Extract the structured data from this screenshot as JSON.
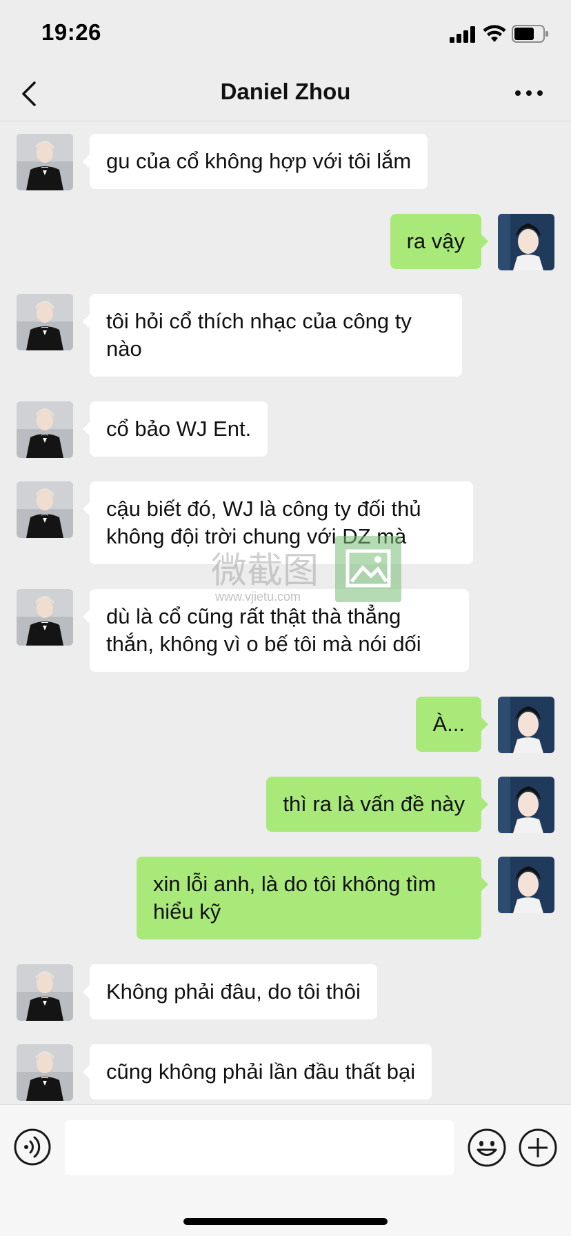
{
  "status_bar": {
    "time": "19:26"
  },
  "header": {
    "title": "Daniel Zhou"
  },
  "messages": [
    {
      "side": "left",
      "text": "gu của cổ không hợp với tôi lắm"
    },
    {
      "side": "right",
      "text": "ra vậy"
    },
    {
      "side": "left",
      "text": "tôi hỏi cổ thích nhạc của công ty nào"
    },
    {
      "side": "left",
      "text": "cổ bảo WJ Ent."
    },
    {
      "side": "left",
      "text": "cậu biết đó, WJ là công ty đối thủ không đội trời chung với DZ mà"
    },
    {
      "side": "left",
      "text": "dù là cổ cũng rất thật thà thẳng thắn, không vì o bế tôi mà nói dối"
    },
    {
      "side": "right",
      "text": "À..."
    },
    {
      "side": "right",
      "text": "thì ra là vấn đề này"
    },
    {
      "side": "right",
      "text": "xin lỗi anh, là do tôi không tìm hiểu kỹ"
    },
    {
      "side": "left",
      "text": "Không phải đâu, do tôi thôi"
    },
    {
      "side": "left",
      "text": "cũng không phải lần đầu thất bại"
    }
  ],
  "watermark": {
    "name": "微截图",
    "url": "www.vjietu.com"
  },
  "input": {
    "value": "",
    "placeholder": ""
  },
  "icons": {
    "back": "chevron-left-icon",
    "more": "more-dots-icon",
    "voice": "voice-icon",
    "emoji": "emoji-icon",
    "add": "plus-circle-icon"
  },
  "colors": {
    "sent_bubble": "#a9e97a",
    "received_bubble": "#ffffff",
    "background": "#ededed"
  }
}
